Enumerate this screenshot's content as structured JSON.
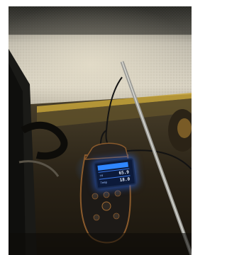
{
  "image": {
    "description_key": "photo",
    "accent_colors": {
      "wall": "#c9c3b4",
      "tape": "#c7a53a",
      "screen_glow": "#2f86ff",
      "device_trim": "#8a5a2c",
      "rod": "#b9b9b5"
    }
  },
  "device_screen": {
    "row1_label": "rH",
    "row1_value": "65.9",
    "row2_label": "Temp",
    "row2_value": "18.0"
  }
}
